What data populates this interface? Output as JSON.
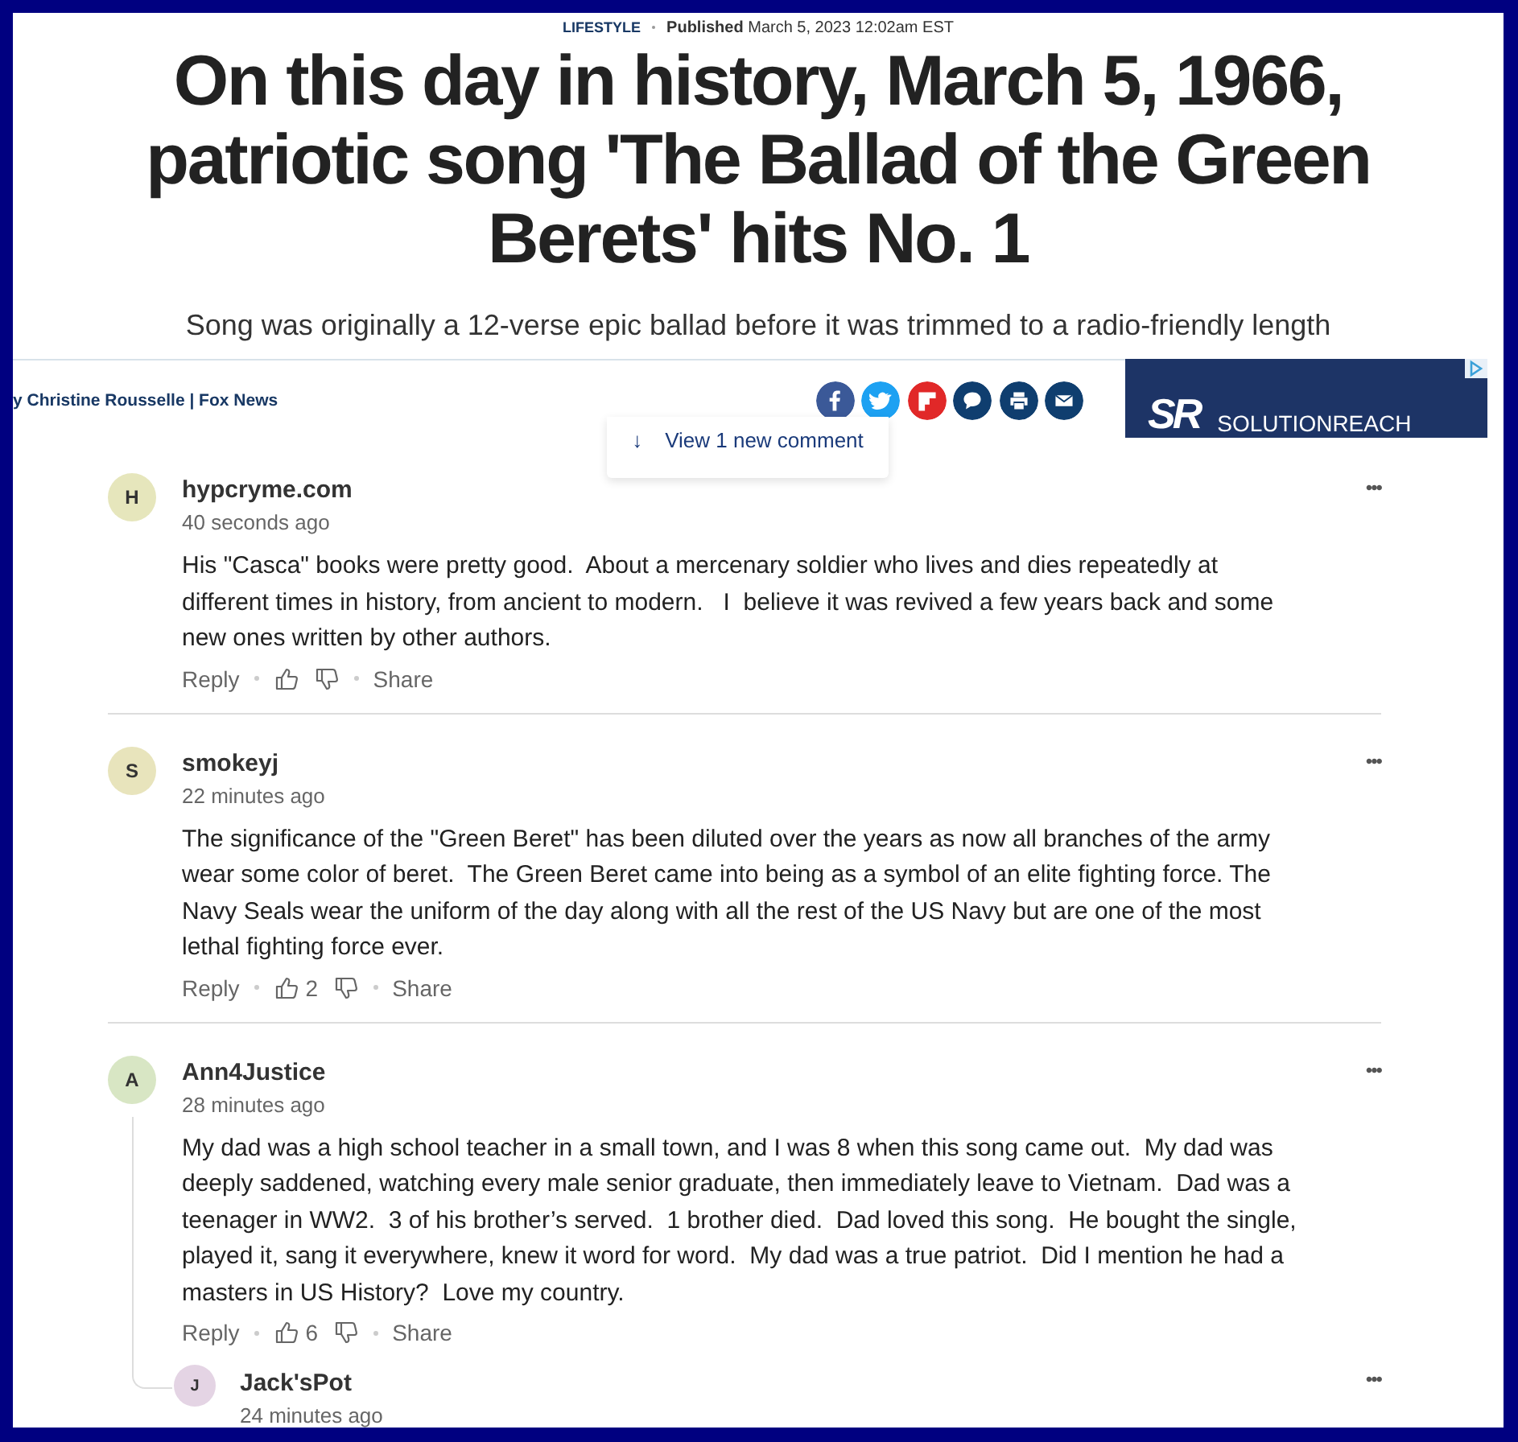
{
  "article": {
    "category": "LIFESTYLE",
    "published_label": "Published",
    "published_date": "March 5, 2023 12:02am EST",
    "headline": "On this day in history, March 5, 1966, patriotic song 'The Ballad of the Green Berets' hits No. 1",
    "subheadline": "Song was originally a 12-verse epic ballad before it was trimmed to a radio-friendly length",
    "byline": "y Christine Rousselle | Fox News",
    "share_buttons": [
      {
        "kind": "facebook"
      },
      {
        "kind": "twitter"
      },
      {
        "kind": "flipboard"
      },
      {
        "kind": "comment"
      },
      {
        "kind": "print"
      },
      {
        "kind": "email"
      }
    ]
  },
  "ad": {
    "logo": "SR",
    "brand": "SOLUTIONREACH"
  },
  "new_comments_button": {
    "arrow": "↓",
    "label": "View 1 new comment"
  },
  "comments": [
    {
      "avatar": "H",
      "color": "#e6e6bc",
      "author": "hypcryme.com",
      "time": "40 seconds ago",
      "text": "His \"Casca\" books were pretty good.  About a mercenary soldier who lives and dies repeatedly at different times in history, from ancient to modern.   I  believe it was revived a few years back and some new ones written by other authors.",
      "reply_label": "Reply",
      "share_label": "Share",
      "menu": "•••"
    },
    {
      "avatar": "S",
      "color": "#e8e4bc",
      "author": "smokeyj",
      "time": "22 minutes ago",
      "text": "The significance of the \"Green Beret\" has been diluted over the years as now all branches of the army wear some color of beret.  The Green Beret came into being as a symbol of an elite fighting force. The Navy Seals wear the uniform of the day along with all the rest of the US Navy but are one of the most lethal fighting force ever.",
      "reply_label": "Reply",
      "likes": "2",
      "share_label": "Share",
      "menu": "•••"
    },
    {
      "avatar": "A",
      "color": "#d8e6c4",
      "author": "Ann4Justice",
      "time": "28 minutes ago",
      "text": "My dad was a high school teacher in a small town, and I was 8 when this song came out.  My dad was deeply saddened, watching every male senior graduate, then immediately leave to Vietnam.  Dad was a teenager in WW2.  3 of his brother’s served.  1 brother died.  Dad loved this song.  He bought the single, played it, sang it everywhere, knew it word for word.  My dad was a true patriot.  Did I mention he had a masters in US History?  Love my country.",
      "reply_label": "Reply",
      "likes": "6",
      "share_label": "Share",
      "menu": "•••",
      "replies": [
        {
          "avatar": "J",
          "color": "#e4d4e4",
          "author": "Jack'sPot",
          "time": "24 minutes ago",
          "menu": "•••"
        }
      ]
    }
  ]
}
